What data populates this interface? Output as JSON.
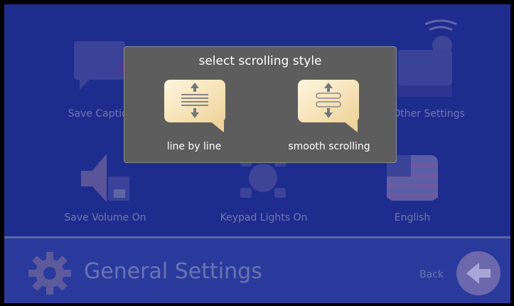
{
  "background_tiles": [
    {
      "label": "Save Caption",
      "icon": "caption-bubble-icon"
    },
    {
      "label": "Other Settings",
      "icon": "wifi-device-icon"
    },
    {
      "label": "Save Volume On",
      "icon": "speaker-save-icon"
    },
    {
      "label": "Keypad Lights On",
      "icon": "keypad-icon"
    },
    {
      "label": "English",
      "icon": "us-flag-icon"
    }
  ],
  "footer": {
    "title": "General Settings",
    "back_label": "Back"
  },
  "dialog": {
    "title": "select scrolling style",
    "options": [
      {
        "label": "line by line",
        "icon": "line-by-line-icon"
      },
      {
        "label": "smooth scrolling",
        "icon": "smooth-scrolling-icon"
      }
    ]
  },
  "colors": {
    "background": "#1e2c8e",
    "dialog": "#5d5d5d",
    "bubble": "#f6e3b4"
  }
}
